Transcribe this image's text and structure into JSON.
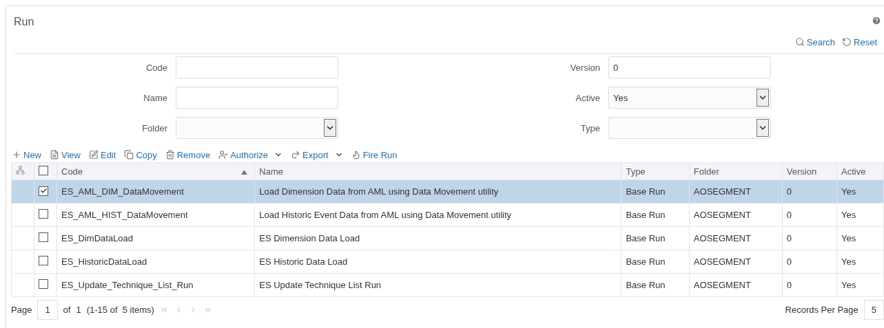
{
  "title": "Run",
  "header_actions": [
    {
      "kind": "search",
      "label": "Search"
    },
    {
      "kind": "reset",
      "label": "Reset"
    }
  ],
  "form_left": [
    {
      "label": "Code",
      "kind": "text"
    },
    {
      "label": "Name",
      "kind": "text"
    },
    {
      "label": "Folder",
      "kind": "select"
    }
  ],
  "form_right": [
    {
      "label": "Version",
      "kind": "text",
      "value": "0"
    },
    {
      "label": "Active",
      "kind": "select",
      "value": "Yes"
    },
    {
      "label": "Type",
      "kind": "select"
    }
  ],
  "toolbar": [
    {
      "kind": "new",
      "label": "New",
      "has_menu": false
    },
    {
      "kind": "view",
      "label": "View",
      "has_menu": false
    },
    {
      "kind": "edit",
      "label": "Edit",
      "has_menu": false
    },
    {
      "kind": "copy",
      "label": "Copy",
      "has_menu": false
    },
    {
      "kind": "remove",
      "label": "Remove",
      "has_menu": false
    },
    {
      "kind": "authorize",
      "label": "Authorize",
      "has_menu": true
    },
    {
      "kind": "export",
      "label": "Export",
      "has_menu": true
    },
    {
      "kind": "fire",
      "label": "Fire Run",
      "has_menu": false
    }
  ],
  "table": {
    "all_checked": false,
    "columns": [
      {
        "label": "Code",
        "sorted": true
      },
      {
        "label": "Name",
        "sorted": false
      },
      {
        "label": "Type",
        "sorted": false
      },
      {
        "label": "Folder",
        "sorted": false
      },
      {
        "label": "Version",
        "sorted": false
      },
      {
        "label": "Active",
        "sorted": false
      }
    ],
    "rows": [
      {
        "selected": true,
        "checked": true,
        "cells": [
          "ES_AML_DIM_DataMovement",
          "Load Dimension Data from AML using Data Movement utility",
          "Base Run",
          "AOSEGMENT",
          "0",
          "Yes"
        ]
      },
      {
        "selected": false,
        "checked": false,
        "cells": [
          "ES_AML_HIST_DataMovement",
          "Load Historic Event Data from AML using Data Movement utility",
          "Base Run",
          "AOSEGMENT",
          "0",
          "Yes"
        ]
      },
      {
        "selected": false,
        "checked": false,
        "cells": [
          "ES_DimDataLoad",
          "ES Dimension Data Load",
          "Base Run",
          "AOSEGMENT",
          "0",
          "Yes"
        ]
      },
      {
        "selected": false,
        "checked": false,
        "cells": [
          "ES_HistoricDataLoad",
          "ES Historic Data Load",
          "Base Run",
          "AOSEGMENT",
          "0",
          "Yes"
        ]
      },
      {
        "selected": false,
        "checked": false,
        "cells": [
          "ES_Update_Technique_List_Run",
          "ES Update Technique List Run",
          "Base Run",
          "AOSEGMENT",
          "0",
          "Yes"
        ]
      }
    ]
  },
  "pager": {
    "page_label": "Page",
    "page": "1",
    "of_label": "of",
    "total_pages": "1",
    "range": "(1-15 of  5 items)",
    "records_label": "Records Per Page",
    "records": "5"
  }
}
